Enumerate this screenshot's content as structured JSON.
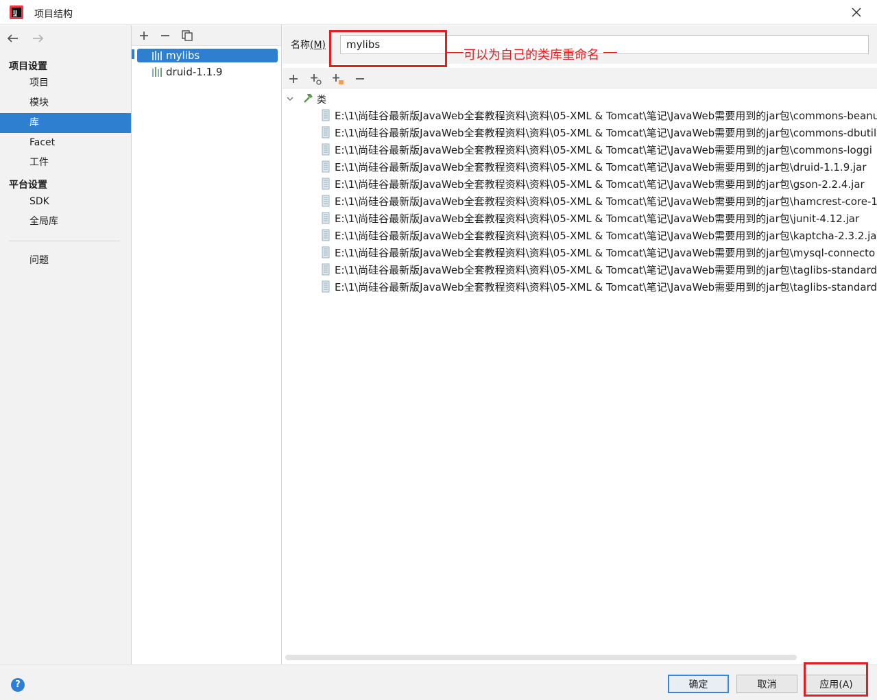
{
  "window": {
    "title": "项目结构",
    "app_icon": "intellij-idea-icon",
    "close_icon": "close-icon"
  },
  "nav": {
    "back_icon": "arrow-left-icon",
    "forward_icon": "arrow-right-icon"
  },
  "sidebar": {
    "project_settings_header": "项目设置",
    "project_items": [
      {
        "label": "项目"
      },
      {
        "label": "模块"
      },
      {
        "label": "库",
        "selected": true
      },
      {
        "label": "Facet"
      },
      {
        "label": "工件"
      }
    ],
    "platform_settings_header": "平台设置",
    "platform_items": [
      {
        "label": "SDK"
      },
      {
        "label": "全局库"
      }
    ],
    "problems_label": "问题"
  },
  "libraries": {
    "toolbar_icons": [
      "add-icon",
      "remove-icon",
      "copy-icon"
    ],
    "items": [
      {
        "label": "mylibs",
        "selected": true
      },
      {
        "label": "druid-1.1.9",
        "selected": false
      }
    ]
  },
  "detail": {
    "name_label": "名称",
    "name_mnemonic": "(M)",
    "name_value": "mylibs",
    "annotation": "可以为自己的类库重命名",
    "toolbar_icons": [
      "add-icon",
      "add-attached-icon",
      "add-jar-icon",
      "remove-icon"
    ],
    "tree_root_label": "类",
    "jar_paths": [
      "E:\\1\\尚硅谷最新版JavaWeb全套教程资料\\资料\\05-XML & Tomcat\\笔记\\JavaWeb需要用到的jar包\\commons-beanu",
      "E:\\1\\尚硅谷最新版JavaWeb全套教程资料\\资料\\05-XML & Tomcat\\笔记\\JavaWeb需要用到的jar包\\commons-dbutil",
      "E:\\1\\尚硅谷最新版JavaWeb全套教程资料\\资料\\05-XML & Tomcat\\笔记\\JavaWeb需要用到的jar包\\commons-loggi",
      "E:\\1\\尚硅谷最新版JavaWeb全套教程资料\\资料\\05-XML & Tomcat\\笔记\\JavaWeb需要用到的jar包\\druid-1.1.9.jar",
      "E:\\1\\尚硅谷最新版JavaWeb全套教程资料\\资料\\05-XML & Tomcat\\笔记\\JavaWeb需要用到的jar包\\gson-2.2.4.jar",
      "E:\\1\\尚硅谷最新版JavaWeb全套教程资料\\资料\\05-XML & Tomcat\\笔记\\JavaWeb需要用到的jar包\\hamcrest-core-1",
      "E:\\1\\尚硅谷最新版JavaWeb全套教程资料\\资料\\05-XML & Tomcat\\笔记\\JavaWeb需要用到的jar包\\junit-4.12.jar",
      "E:\\1\\尚硅谷最新版JavaWeb全套教程资料\\资料\\05-XML & Tomcat\\笔记\\JavaWeb需要用到的jar包\\kaptcha-2.3.2.jar",
      "E:\\1\\尚硅谷最新版JavaWeb全套教程资料\\资料\\05-XML & Tomcat\\笔记\\JavaWeb需要用到的jar包\\mysql-connecto",
      "E:\\1\\尚硅谷最新版JavaWeb全套教程资料\\资料\\05-XML & Tomcat\\笔记\\JavaWeb需要用到的jar包\\taglibs-standard",
      "E:\\1\\尚硅谷最新版JavaWeb全套教程资料\\资料\\05-XML & Tomcat\\笔记\\JavaWeb需要用到的jar包\\taglibs-standard"
    ]
  },
  "footer": {
    "help_label": "?",
    "ok_label": "确定",
    "cancel_label": "取消",
    "apply_label": "应用(A)"
  },
  "colors": {
    "selection": "#2f7fd1",
    "annotation": "#e02020",
    "panel_bg": "#f2f2f2"
  }
}
